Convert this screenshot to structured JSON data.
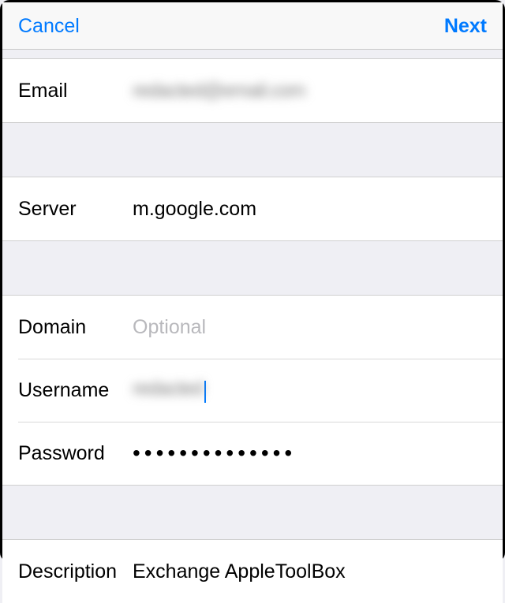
{
  "navbar": {
    "cancel": "Cancel",
    "next": "Next"
  },
  "email": {
    "label": "Email",
    "value": "redacted@email.com"
  },
  "server": {
    "label": "Server",
    "value": "m.google.com"
  },
  "domain": {
    "label": "Domain",
    "placeholder": "Optional",
    "value": ""
  },
  "username": {
    "label": "Username",
    "value": "redacted"
  },
  "password": {
    "label": "Password",
    "value": "••••••••••••••"
  },
  "description": {
    "label": "Description",
    "value": "Exchange AppleToolBox"
  }
}
